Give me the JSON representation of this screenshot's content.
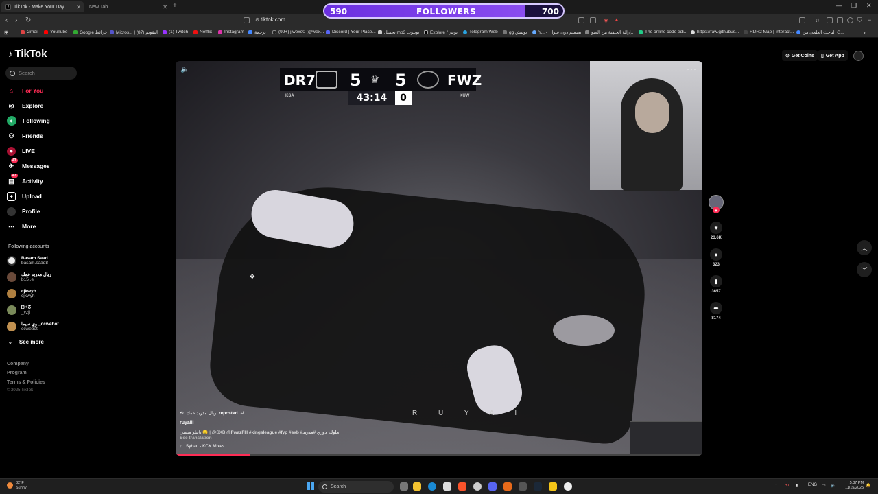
{
  "browser": {
    "tabs": [
      {
        "title": "TikTok - Make Your Day",
        "active": true
      },
      {
        "title": "New Tab",
        "active": false
      }
    ],
    "url": "tiktok.com",
    "bookmarks": [
      "Gmail",
      "YouTube",
      "Google خرائط",
      "Micros... | التقويم (87)",
      "(1) Twitch",
      "Netflix",
      "Instagram",
      "ترجمة",
      "(99+) jiwexo0 (@wex...",
      "Discord | Your Place...",
      "تحميل mp3 يوتيوب",
      "Explore / تويتر",
      "Telegram Web",
      "gg توبتش",
      "Y... - تصميم دون عنوان",
      "إزالة الخلفية من الصو...",
      "The online code edi...",
      "https://raw.githubus...",
      "RDR2 Map | Interact...",
      "الباحث العلمي من G..."
    ]
  },
  "followers_overlay": {
    "current": "590",
    "label": "FOLLOWERS",
    "goal": "700",
    "progress_fraction": 0.843
  },
  "sidebar": {
    "logo": "TikTok",
    "search_placeholder": "Search",
    "nav": [
      {
        "label": "For You",
        "icon": "home-icon",
        "active": true
      },
      {
        "label": "Explore",
        "icon": "compass-icon"
      },
      {
        "label": "Following",
        "icon": "following-icon"
      },
      {
        "label": "Friends",
        "icon": "friends-icon"
      },
      {
        "label": "LIVE",
        "icon": "live-icon"
      },
      {
        "label": "Messages",
        "icon": "messages-icon",
        "badge": "43"
      },
      {
        "label": "Activity",
        "icon": "activity-icon",
        "badge": "47"
      },
      {
        "label": "Upload",
        "icon": "upload-icon"
      },
      {
        "label": "Profile",
        "icon": "profile-icon"
      },
      {
        "label": "More",
        "icon": "more-icon"
      }
    ],
    "following_title": "Following accounts",
    "accounts": [
      {
        "name": "Basam Saad",
        "handle": "basam.saad8"
      },
      {
        "name": "ريال مدريد عمك",
        "handle": "b15..e"
      },
      {
        "name": "cjkwyh",
        "handle": "cjkwyh"
      },
      {
        "name": "ᗷ ᵗ ᘔ",
        "handle": "_vzji"
      },
      {
        "name": "وي سيما _ccwebot",
        "handle": "ccwebot_"
      }
    ],
    "see_more": "See more",
    "footer_links": [
      "Company",
      "Program",
      "Terms & Policies"
    ],
    "copyright": "© 2025 TikTok"
  },
  "topbar": {
    "get_coins": "Get Coins",
    "get_app": "Get App"
  },
  "video": {
    "scoreboard": {
      "home_team": "DR7",
      "home_score": "5",
      "away_score": "5",
      "away_team": "FWZ",
      "home_tag": "KSA",
      "away_tag": "KUW",
      "clock": "43:14",
      "extra": "0"
    },
    "repost_text": "ريال مدريد عمك",
    "repost_label": "reposted",
    "author": "ruyaiii",
    "description": "ناتيلو ميسي 😢 | @SXB",
    "hashtags": "@FwazFH #kingsleague #fyp #sxb #ملوك_دوري #مدريد",
    "see_translation": "See translation",
    "music": "Sybau - KCK Mixes",
    "watermark": "R U Y A I",
    "progress_fraction": 0.14
  },
  "actions": {
    "likes": "23.6K",
    "comments": "323",
    "saves": "3657",
    "shares": "8174"
  },
  "taskbar": {
    "temperature": "82°F",
    "weather": "Sunny",
    "search": "Search",
    "lang": "ENG",
    "time": "5:37 PM",
    "date": "11/15/2025"
  }
}
